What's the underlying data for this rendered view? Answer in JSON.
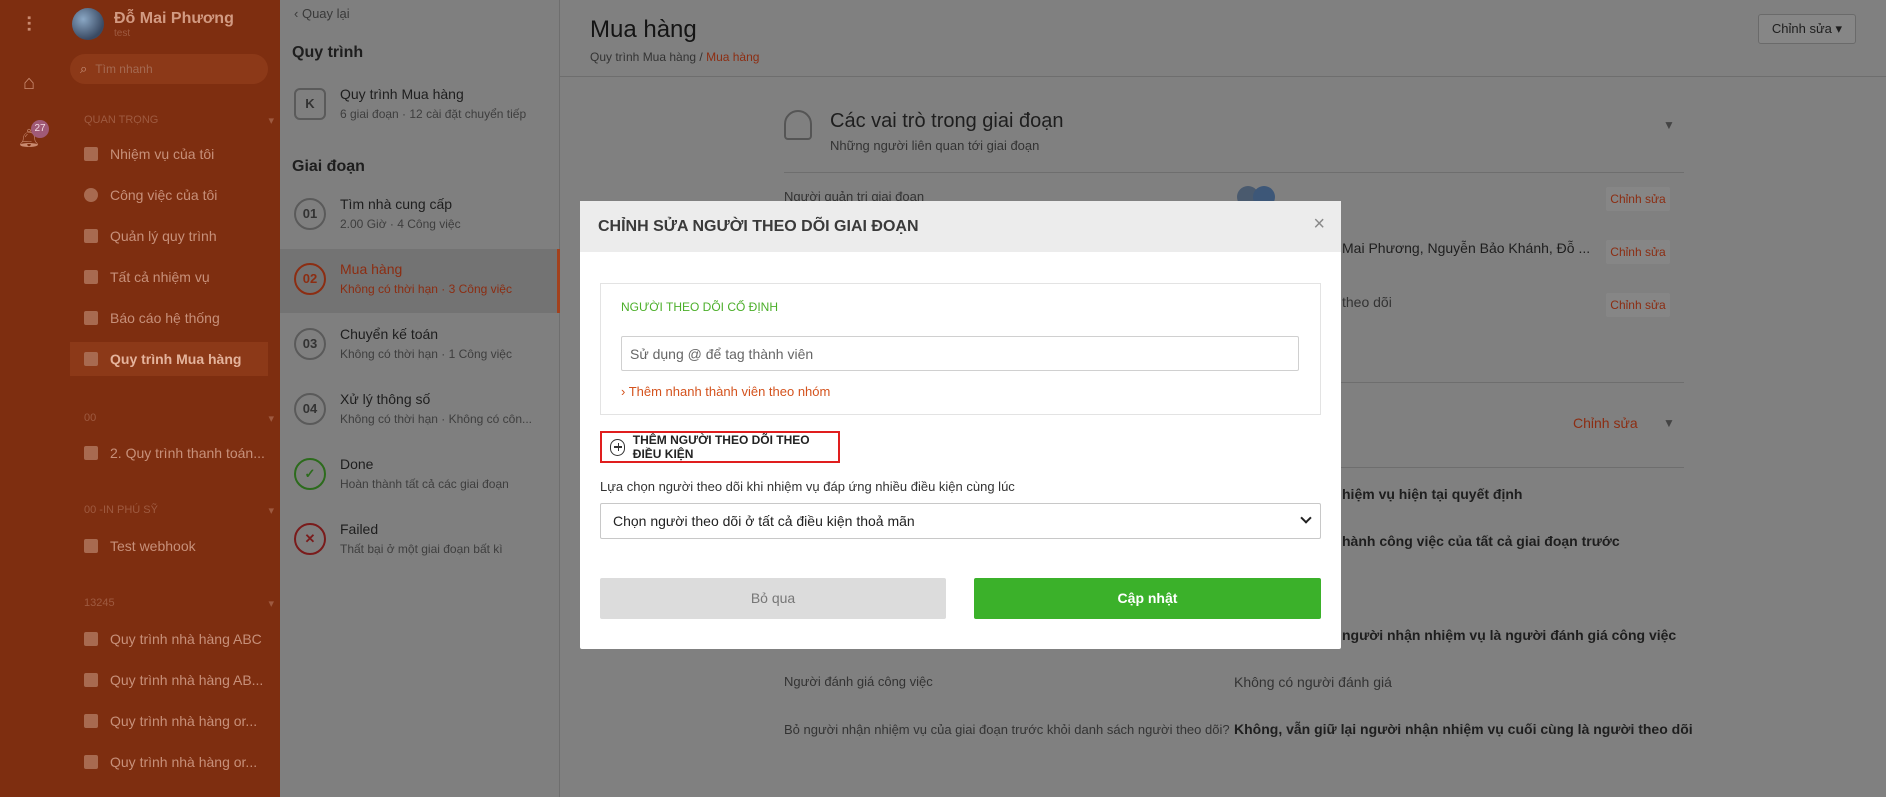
{
  "sidebar": {
    "user_name": "Đỗ Mai Phương",
    "user_sub": "test",
    "search_placeholder": "Tìm nhanh",
    "notification_count": "27",
    "section_important": "QUAN TRỌNG",
    "important_items": [
      {
        "label": "Nhiệm vụ của tôi"
      },
      {
        "label": "Công việc của tôi"
      },
      {
        "label": "Quản lý quy trình"
      },
      {
        "label": "Tất cả nhiệm vụ"
      },
      {
        "label": "Báo cáo hệ thống"
      },
      {
        "label": "Quy trình Mua hàng"
      }
    ],
    "section_00": "00",
    "item_00": "2. Quy trình thanh toán...",
    "section_phusy": "00 -IN PHÚ SỸ",
    "item_phusy": "Test webhook",
    "section_13245": "13245",
    "items_13245": [
      {
        "label": "Quy trình nhà hàng ABC"
      },
      {
        "label": "Quy trình nhà hàng AB..."
      },
      {
        "label": "Quy trình nhà hàng or..."
      },
      {
        "label": "Quy trình nhà hàng or..."
      }
    ]
  },
  "middle": {
    "back": "Quay lại",
    "section_process": "Quy trình",
    "process_title": "Quy trình Mua hàng",
    "process_sub": "6 giai đoạn · 12 cài đặt chuyển tiếp",
    "section_stages": "Giai đoạn",
    "stages": [
      {
        "num": "01",
        "title": "Tìm nhà cung cấp",
        "sub": "2.00 Giờ · 4 Công việc"
      },
      {
        "num": "02",
        "title": "Mua hàng",
        "sub": "Không có thời hạn · 3 Công việc"
      },
      {
        "num": "03",
        "title": "Chuyển kế toán",
        "sub": "Không có thời hạn · 1 Công việc"
      },
      {
        "num": "04",
        "title": "Xử lý thông số",
        "sub": "Không có thời hạn · Không có côn..."
      },
      {
        "num": "",
        "title": "Done",
        "sub": "Hoàn thành tất cả các giai đoạn"
      },
      {
        "num": "",
        "title": "Failed",
        "sub": "Thất bại ở một giai đoạn bất kì"
      }
    ]
  },
  "main": {
    "title": "Mua hàng",
    "breadcrumb_root": "Quy trình Mua hàng",
    "breadcrumb_sep": " / ",
    "breadcrumb_current": "Mua hàng",
    "edit_button": "Chỉnh sửa",
    "roles_title": "Các vai trò trong giai đoạn",
    "roles_sub": "Những người liên quan tới giai đoạn",
    "row1_label": "Người quản trị giai đoạn",
    "row2_value": "Mai Phương, Nguyễn Bảo Khánh, Đỗ ...",
    "row3_value": "theo dõi",
    "edit_small": "Chỉnh sửa",
    "line_a": "hiệm vụ hiện tại quyết định",
    "line_b": "hành công việc của tất cả giai đoạn trước",
    "line_c": "người nhận nhiệm vụ là người đánh giá công việc",
    "reviewer_label": "Người đánh giá công việc",
    "reviewer_value": "Không có người đánh giá",
    "remove_label": "Bỏ người nhận nhiệm vụ của giai đoạn trước khỏi danh sách người theo dõi?",
    "remove_value": "Không, vẫn giữ lại người nhận nhiệm vụ cuối cùng là người theo dõi"
  },
  "modal": {
    "title": "CHỈNH SỬA NGƯỜI THEO DÕI GIAI ĐOẠN",
    "close": "×",
    "fixed_label": "NGƯỜI THEO DÕI CỐ ĐỊNH",
    "tag_placeholder": "Sử dụng @ để tag thành viên",
    "quick_add": "› Thêm nhanh thành viên theo nhóm",
    "add_condition": "THÊM NGƯỜI THEO DÕI THEO ĐIỀU KIỆN",
    "select_label": "Lựa chọn người theo dõi khi nhiệm vụ đáp ứng nhiều điều kiện cùng lúc",
    "select_value": "Chọn người theo dõi ở tất cả điều kiện thoả mãn",
    "cancel": "Bỏ qua",
    "update": "Cập nhật"
  }
}
